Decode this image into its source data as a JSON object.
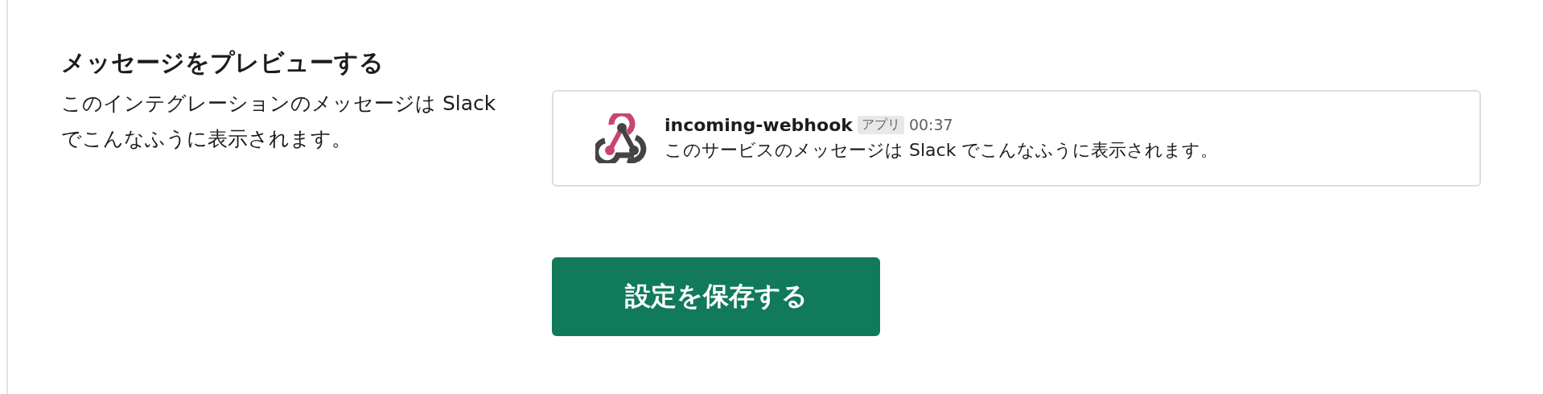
{
  "section": {
    "title": "メッセージをプレビューする",
    "description": "このインテグレーションのメッセージは Slack でこんなふうに表示されます。"
  },
  "preview": {
    "sender": "incoming-webhook",
    "badge": "アプリ",
    "time": "00:37",
    "message": "このサービスのメッセージは Slack でこんなふうに表示されます。"
  },
  "save_button": {
    "label": "設定を保存する"
  }
}
